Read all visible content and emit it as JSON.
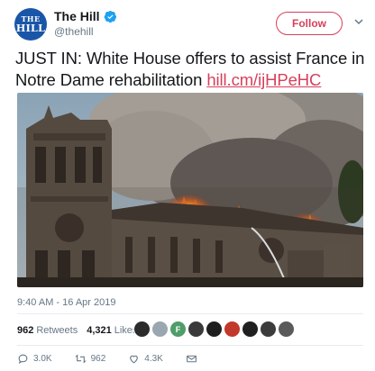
{
  "account": {
    "avatar_line1": "THE",
    "avatar_line2": "HILL",
    "display_name": "The Hill",
    "handle": "@thehill",
    "verified_icon": "verified-badge-icon"
  },
  "follow_button": {
    "label": "Follow"
  },
  "tweet": {
    "text": "JUST IN: White House offers to assist France in Notre Dame rehabilitation",
    "link": "hill.cm/ijHPeHC",
    "timestamp": "9:40 AM - 16 Apr 2019"
  },
  "stats": {
    "retweets_count": "962",
    "retweets_label": "Retweets",
    "likes_count": "4,321",
    "likes_label": "Likes"
  },
  "likers": [
    {
      "initial": "",
      "color": "#2b2b2b"
    },
    {
      "initial": "",
      "color": "#9aa7b0"
    },
    {
      "initial": "F",
      "color": "#4f9d69"
    },
    {
      "initial": "",
      "color": "#3a3a3a"
    },
    {
      "initial": "",
      "color": "#1f1f1f"
    },
    {
      "initial": "",
      "color": "#c0392b"
    },
    {
      "initial": "",
      "color": "#202020"
    },
    {
      "initial": "",
      "color": "#3c3c3c"
    },
    {
      "initial": "",
      "color": "#5a5a5a"
    }
  ],
  "actions": {
    "reply_count": "3.0K",
    "retweet_count": "962",
    "like_count": "4.3K"
  },
  "colors": {
    "accent": "#d6405b",
    "secondary_text": "#657786",
    "primary_text": "#14171a"
  }
}
